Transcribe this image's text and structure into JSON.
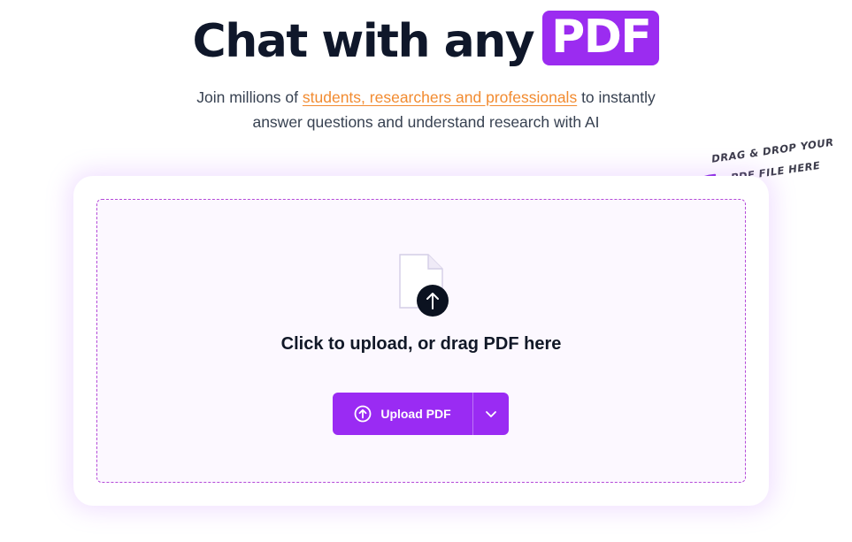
{
  "hero": {
    "title_prefix": "Chat with any",
    "title_highlight": "PDF"
  },
  "subtitle": {
    "before_link": "Join millions of ",
    "link": "students, researchers and professionals",
    "after_link": " to instantly",
    "line2": "answer questions and understand research with AI"
  },
  "hint": {
    "line1": "Drag & drop your",
    "line2": "PDF file here"
  },
  "dropzone": {
    "text": "Click to upload, or drag PDF here",
    "icon": "file-upload-icon"
  },
  "upload_button": {
    "label": "Upload PDF",
    "icon": "upload-circle-icon",
    "dropdown_icon": "chevron-down-icon"
  },
  "colors": {
    "accent": "#9a2bf3",
    "link": "#f28b30",
    "title": "#0f172a",
    "dash": "#b44ad8"
  }
}
